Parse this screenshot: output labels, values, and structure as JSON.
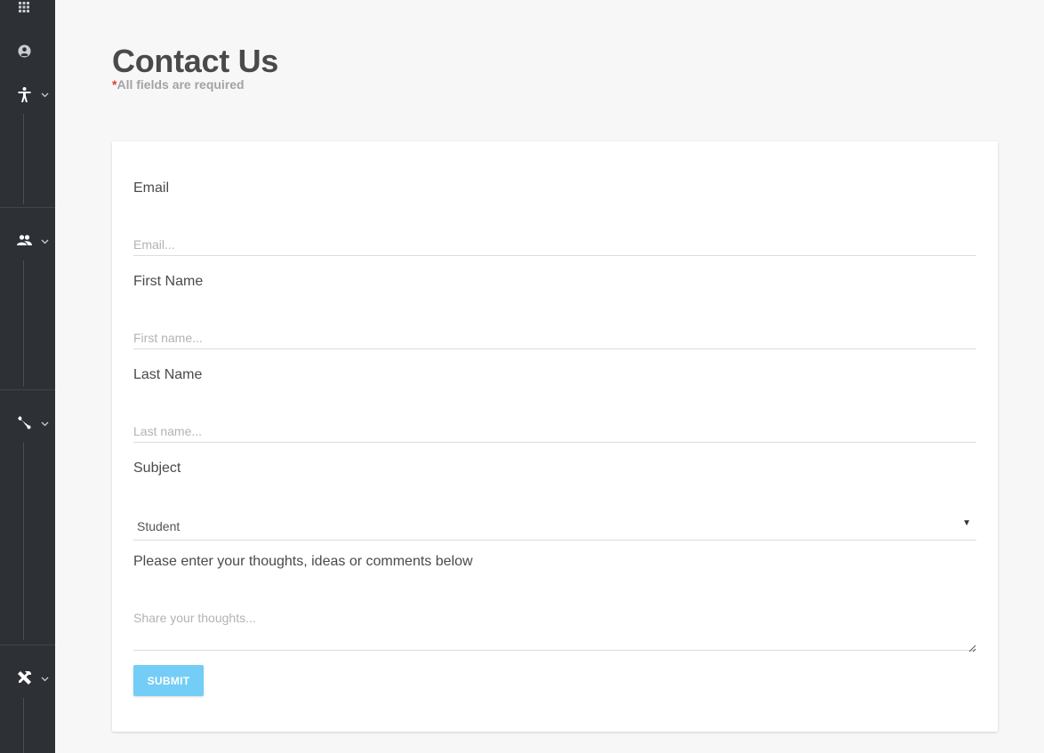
{
  "sidebar": {
    "icons": [
      {
        "name": "apps-grid-icon"
      },
      {
        "name": "account-circle-icon"
      },
      {
        "name": "accessibility-icon"
      },
      {
        "name": "people-icon"
      },
      {
        "name": "wrench-icon"
      },
      {
        "name": "tools-icon"
      }
    ]
  },
  "header": {
    "title": "Contact Us",
    "required_star": "*",
    "required_text": "All fields are required"
  },
  "form": {
    "email": {
      "label": "Email",
      "placeholder": "Email...",
      "value": ""
    },
    "first_name": {
      "label": "First Name",
      "placeholder": "First name...",
      "value": ""
    },
    "last_name": {
      "label": "Last Name",
      "placeholder": "Last name...",
      "value": ""
    },
    "subject": {
      "label": "Subject",
      "selected": "Student"
    },
    "comments": {
      "label": "Please enter your thoughts, ideas or comments below",
      "placeholder": "Share your thoughts..."
    },
    "submit_label": "SUBMIT"
  },
  "colors": {
    "sidebar_bg": "#2d3136",
    "page_bg": "#f7f7f7",
    "accent": "#74cdf6",
    "required_star": "#e53935"
  }
}
